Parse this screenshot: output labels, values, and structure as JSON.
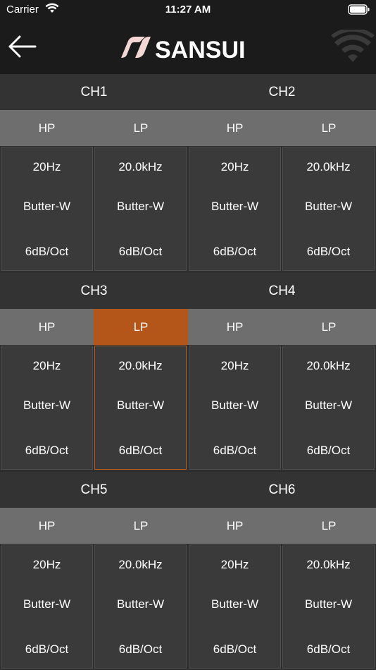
{
  "status_bar": {
    "carrier": "Carrier",
    "time": "11:27 AM",
    "wifi_icon": "wifi-icon",
    "battery_icon": "battery-icon"
  },
  "nav": {
    "back_icon": "arrow-left-icon",
    "brand": "SANSUI",
    "connection_icon": "wifi-icon"
  },
  "colors": {
    "background": "#2e2e2e",
    "bar": "#1b1b1b",
    "tab": "#6e6e6e",
    "tab_active": "#b4561a",
    "cell": "#3a3a3a"
  },
  "channels": [
    {
      "name": "CH1",
      "filters": [
        {
          "label": "HP",
          "freq": "20Hz",
          "type": "Butter-W",
          "slope": "6dB/Oct",
          "active": false
        },
        {
          "label": "LP",
          "freq": "20.0kHz",
          "type": "Butter-W",
          "slope": "6dB/Oct",
          "active": false
        }
      ]
    },
    {
      "name": "CH2",
      "filters": [
        {
          "label": "HP",
          "freq": "20Hz",
          "type": "Butter-W",
          "slope": "6dB/Oct",
          "active": false
        },
        {
          "label": "LP",
          "freq": "20.0kHz",
          "type": "Butter-W",
          "slope": "6dB/Oct",
          "active": false
        }
      ]
    },
    {
      "name": "CH3",
      "filters": [
        {
          "label": "HP",
          "freq": "20Hz",
          "type": "Butter-W",
          "slope": "6dB/Oct",
          "active": false
        },
        {
          "label": "LP",
          "freq": "20.0kHz",
          "type": "Butter-W",
          "slope": "6dB/Oct",
          "active": true
        }
      ]
    },
    {
      "name": "CH4",
      "filters": [
        {
          "label": "HP",
          "freq": "20Hz",
          "type": "Butter-W",
          "slope": "6dB/Oct",
          "active": false
        },
        {
          "label": "LP",
          "freq": "20.0kHz",
          "type": "Butter-W",
          "slope": "6dB/Oct",
          "active": false
        }
      ]
    },
    {
      "name": "CH5",
      "filters": [
        {
          "label": "HP",
          "freq": "20Hz",
          "type": "Butter-W",
          "slope": "6dB/Oct",
          "active": false
        },
        {
          "label": "LP",
          "freq": "20.0kHz",
          "type": "Butter-W",
          "slope": "6dB/Oct",
          "active": false
        }
      ]
    },
    {
      "name": "CH6",
      "filters": [
        {
          "label": "HP",
          "freq": "20Hz",
          "type": "Butter-W",
          "slope": "6dB/Oct",
          "active": false
        },
        {
          "label": "LP",
          "freq": "20.0kHz",
          "type": "Butter-W",
          "slope": "6dB/Oct",
          "active": false
        }
      ]
    }
  ]
}
